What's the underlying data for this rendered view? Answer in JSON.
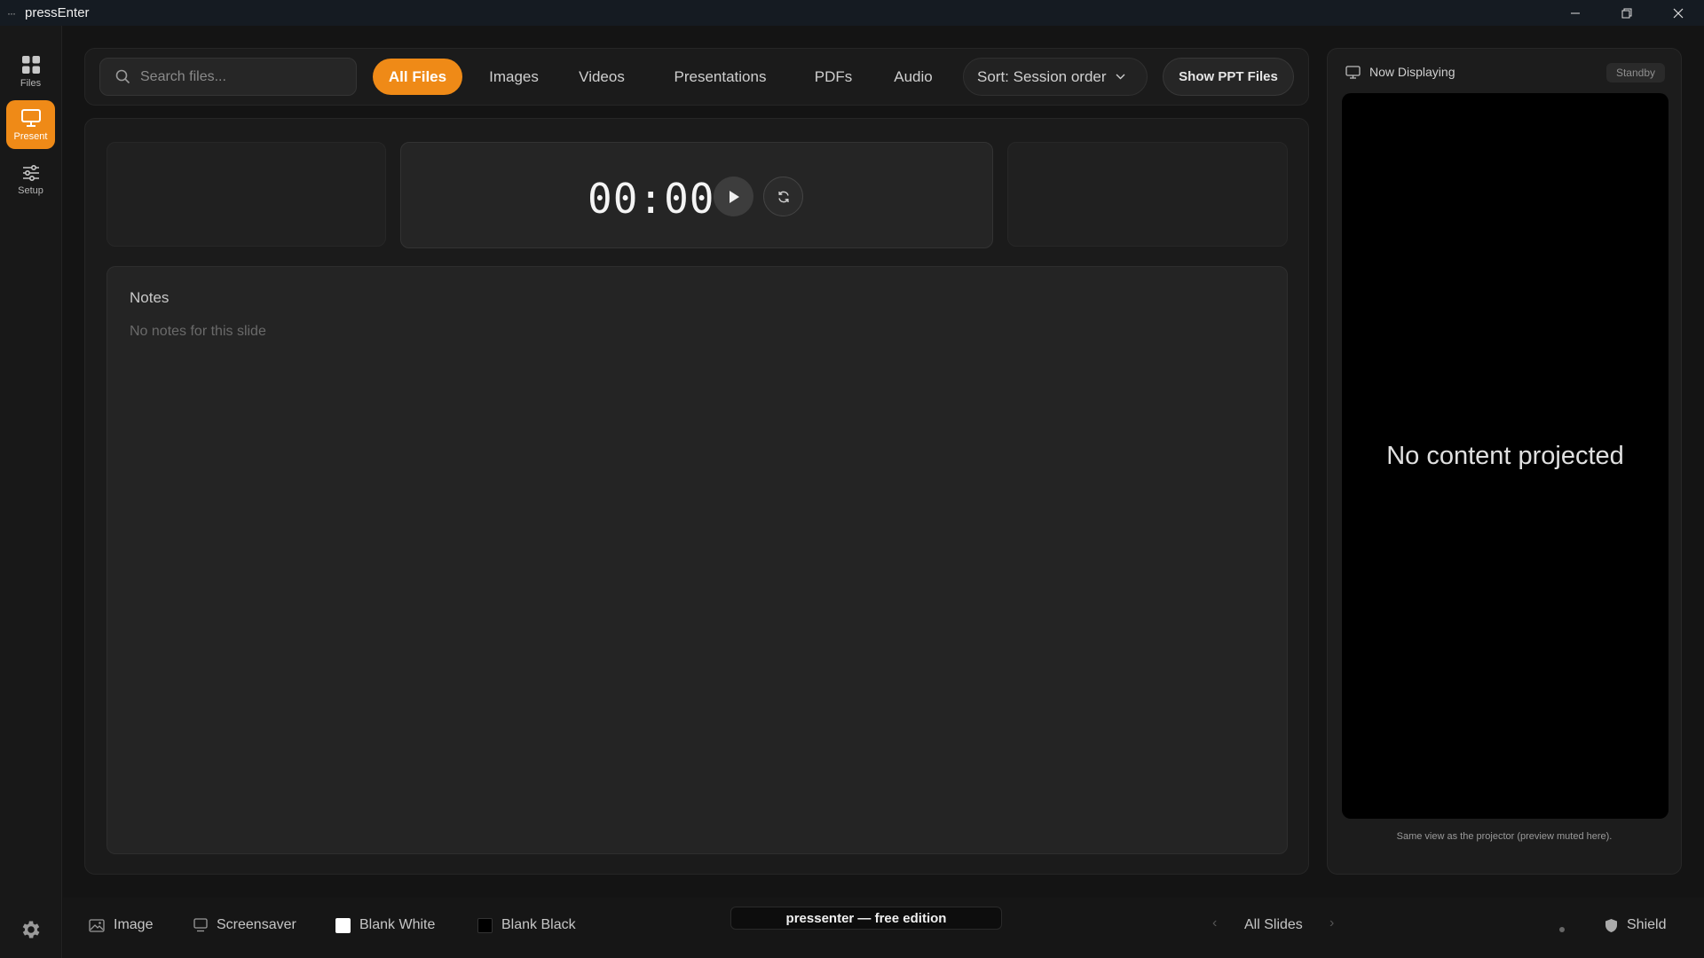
{
  "window": {
    "menu_glyph": "···",
    "title": "pressEnter",
    "controls": [
      "minimize-icon",
      "restore-icon",
      "close-icon"
    ]
  },
  "rail": {
    "items": [
      {
        "label": "Files",
        "icon": "grid-icon",
        "active": false
      },
      {
        "label": "Present",
        "icon": "monitor-icon",
        "active": true
      },
      {
        "label": "Setup",
        "icon": "sliders-icon",
        "active": false
      }
    ],
    "settings_icon": "gear-icon"
  },
  "toolbar": {
    "search_placeholder": "Search files...",
    "tabs": [
      {
        "label": "All Files",
        "active": true
      },
      {
        "label": "Images",
        "active": false
      },
      {
        "label": "Videos",
        "active": false
      },
      {
        "label": "Presentations",
        "active": false
      },
      {
        "label": "PDFs",
        "active": false
      },
      {
        "label": "Audio",
        "active": false
      }
    ],
    "sort_label": "Sort: Session order",
    "show_ppt_label": "Show PPT Files"
  },
  "timer": {
    "value": "00:00"
  },
  "notes": {
    "title": "Notes",
    "empty_text": "No notes for this slide"
  },
  "preview": {
    "header": "Now Displaying",
    "status": "Standby",
    "screen_text": "No content projected",
    "caption": "Same view as the projector (preview muted here)."
  },
  "bottombar": {
    "image_label": "Image",
    "screensaver_label": "Screensaver",
    "blank_white_label": "Blank White",
    "blank_black_label": "Blank Black",
    "edition_label": "pressenter — free edition",
    "prev_arrow": "‹",
    "slides_label": "All Slides",
    "next_arrow": "›",
    "shield_label": "Shield"
  },
  "colors": {
    "accent": "#ef8a17",
    "background": "#141414",
    "panel": "#1b1b1b"
  }
}
